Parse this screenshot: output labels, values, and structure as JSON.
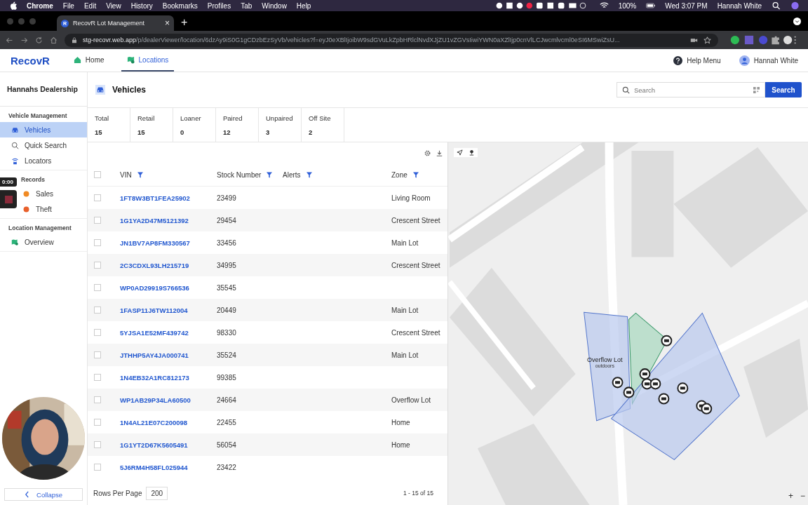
{
  "menubar": {
    "app": "Chrome",
    "menus": [
      "File",
      "Edit",
      "View",
      "History",
      "Bookmarks",
      "Profiles",
      "Tab",
      "Window",
      "Help"
    ],
    "battery": "100%",
    "clock": "Wed 3:07 PM",
    "user": "Hannah White"
  },
  "browser": {
    "tab": {
      "favicon": "R",
      "title": "RecovR Lot Management",
      "close": "×"
    },
    "new_tab": "+",
    "url_host": "stg-recovr.web.app",
    "url_path": "/p/dealerViewer/location/6dzAy9iS0G1gCDzbEzSyVb/vehicles?f=eyJ0eXBlIjoibW9sdGVuLkZpbHRlclNvdXJjZU1vZGVsIiwiYWN0aXZlIjp0cnVlLCJwcmlvcml0eSI6MSwiZsU..."
  },
  "header": {
    "logo": "RecovR",
    "nav": [
      {
        "label": "Home",
        "selected": false
      },
      {
        "label": "Locations",
        "selected": true
      }
    ],
    "help": "Help Menu",
    "user": "Hannah White"
  },
  "sidebar": {
    "title": "Hannahs Dealership",
    "sections": [
      {
        "heading": "Vehicle Management",
        "items": [
          {
            "label": "Vehicles",
            "selected": true
          },
          {
            "label": "Quick Search",
            "selected": false
          },
          {
            "label": "Locators",
            "selected": false
          }
        ]
      },
      {
        "heading": "Records",
        "items": [
          {
            "label": "Sales",
            "selected": false
          },
          {
            "label": "Theft",
            "selected": false
          }
        ]
      },
      {
        "heading": "Location Management",
        "items": [
          {
            "label": "Overview",
            "selected": false
          }
        ]
      }
    ],
    "collapse": "Collapse"
  },
  "recorder": {
    "timer": "0:00"
  },
  "page": {
    "title": "Vehicles",
    "search": {
      "placeholder": "Search"
    },
    "search_button": "Search"
  },
  "stats": [
    {
      "label": "Total",
      "value": "15"
    },
    {
      "label": "Retail",
      "value": "15"
    },
    {
      "label": "Loaner",
      "value": "0"
    },
    {
      "label": "Paired",
      "value": "12"
    },
    {
      "label": "Unpaired",
      "value": "3"
    },
    {
      "label": "Off Site",
      "value": "2"
    }
  ],
  "table": {
    "all_checked": false,
    "columns": [
      {
        "label": "VIN",
        "filter": true
      },
      {
        "label": "Stock Number",
        "filter": true
      },
      {
        "label": "Alerts",
        "filter": true
      },
      {
        "label": "Zone",
        "filter": true
      }
    ],
    "rows": [
      {
        "checked": false,
        "vin": "1FT8W3BT1FEA25902",
        "stock": "23499",
        "zone": "Living Room"
      },
      {
        "checked": false,
        "vin": "1G1YA2D47M5121392",
        "stock": "29454",
        "zone": "Crescent Street"
      },
      {
        "checked": false,
        "vin": "JN1BV7AP8FM330567",
        "stock": "33456",
        "zone": "Main Lot"
      },
      {
        "checked": false,
        "vin": "2C3CDXL93LH215719",
        "stock": "34995",
        "zone": "Crescent Street"
      },
      {
        "checked": false,
        "vin": "WP0AD29919S766536",
        "stock": "35545"
      },
      {
        "checked": false,
        "vin": "1FASP11J6TW112004",
        "stock": "20449",
        "zone": "Main Lot"
      },
      {
        "checked": false,
        "vin": "5YJSA1E52MF439742",
        "stock": "98330",
        "zone": "Crescent Street"
      },
      {
        "checked": false,
        "vin": "JTHHP5AY4JA000741",
        "stock": "35524",
        "zone": "Main Lot"
      },
      {
        "checked": false,
        "vin": "1N4EB32A1RC812173",
        "stock": "99385"
      },
      {
        "checked": false,
        "vin": "WP1AB29P34LA60500",
        "stock": "24664",
        "zone": "Overflow Lot"
      },
      {
        "checked": false,
        "vin": "1N4AL21E07C200098",
        "stock": "22455",
        "zone": "Home"
      },
      {
        "checked": false,
        "vin": "1G1YT2D67K5605491",
        "stock": "56054",
        "zone": "Home"
      },
      {
        "checked": false,
        "vin": "5J6RM4H58FL025944",
        "stock": "23422"
      }
    ]
  },
  "footer": {
    "rows_per_page_label": "Rows Per Page",
    "rows_per_page": "200",
    "range": "1 - 15 of 15"
  },
  "map": {
    "zone_label": "Overflow Lot",
    "zone_sublabel": "outdoors",
    "zoom_in": "+",
    "zoom_out": "−"
  }
}
